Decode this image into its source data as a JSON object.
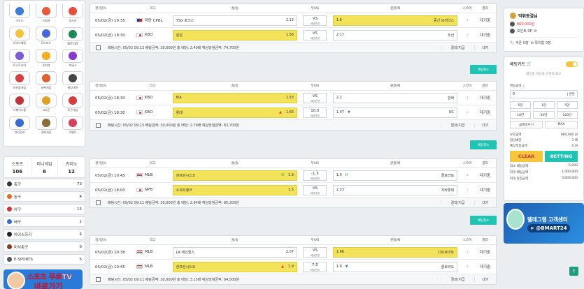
{
  "left_menu": {
    "icons": [
      {
        "label": "크로스",
        "color": "#3c7ad9"
      },
      {
        "label": "스페셜",
        "color": "#e85b3a"
      },
      {
        "label": "실시간",
        "color": "#e8503c"
      },
      {
        "label": "라이브배팅",
        "color": "#f6c33a"
      },
      {
        "label": "E스포츠",
        "color": "#4a66d8"
      },
      {
        "label": "BET365",
        "color": "#1c8a52"
      },
      {
        "label": "토스트리아",
        "color": "#7a5ad8"
      },
      {
        "label": "슈퍼맨",
        "color": "#f0b020"
      },
      {
        "label": "파워스",
        "color": "#8a3ad0"
      },
      {
        "label": "파워볼게임",
        "color": "#d84040"
      },
      {
        "label": "슬롯게임",
        "color": "#e06030"
      },
      {
        "label": "배팅내역",
        "color": "#444444"
      },
      {
        "label": "스페이스볼",
        "color": "#c0303a"
      },
      {
        "label": "크라운",
        "color": "#e0a020"
      },
      {
        "label": "토큰게임",
        "color": "#d83a3a"
      },
      {
        "label": "경기검색",
        "color": "#3a6ad8"
      },
      {
        "label": "경매게임",
        "color": "#8a6a3a"
      },
      {
        "label": "이벤트",
        "color": "#d84060"
      }
    ],
    "counts": [
      {
        "title": "스포츠",
        "num": "106"
      },
      {
        "title": "미니게임",
        "num": "6"
      },
      {
        "title": "카지노",
        "num": "12"
      }
    ],
    "sports": [
      {
        "name": "축구",
        "count": "73",
        "color": "#333333"
      },
      {
        "name": "농구",
        "count": "4",
        "color": "#e07020"
      },
      {
        "name": "야구",
        "count": "15",
        "color": "#c33"
      },
      {
        "name": "배구",
        "count": "1",
        "color": "#3a6ad8"
      },
      {
        "name": "아이스하키",
        "count": "4",
        "color": "#222222"
      },
      {
        "name": "미식축구",
        "count": "0",
        "color": "#8a3a20"
      },
      {
        "name": "E-SPORTS",
        "count": "5",
        "color": "#555555"
      }
    ],
    "banner": {
      "line1": "스포츠 무료TV",
      "line2": "바로가기"
    }
  },
  "header": {
    "time": "경기일시",
    "league": "리그",
    "home": "홈/승",
    "vs": "무/VS",
    "away": "원정/패",
    "score": "스코어",
    "result": "결과"
  },
  "slips": [
    {
      "rows": [
        {
          "time": "05/02(금) 19:35",
          "flag": "tw",
          "league": "대만 CPBL",
          "home": "TSG 호크스",
          "home_odd": "2.13",
          "home_sel": false,
          "home_up": false,
          "vs1": "VS",
          "vs2": "배당변경",
          "away": "중신 브러더스",
          "away_odd": "1.6",
          "away_sel": true,
          "away_dn": false,
          "score": ":",
          "result": "대기중"
        },
        {
          "time": "05/02(금) 18:30",
          "flag": "kr",
          "league": "KBO",
          "home": "삼성",
          "home_odd": "1.56",
          "home_sel": true,
          "home_up": false,
          "vs1": "VS",
          "vs2": "배당변경",
          "away": "두산",
          "away_odd": "2.17",
          "away_sel": false,
          "away_dn": false,
          "score": ":",
          "result": "대기중"
        }
      ],
      "footer": {
        "info": "배팅시간: 05/02 09:13   배팅금액: 30,000원   총 배당: 2.49배   예상당첨금액: 74,700원",
        "f1": "결과/지급",
        "f2": "대기"
      },
      "cancel": "배팅취소"
    },
    {
      "rows": [
        {
          "time": "05/02(금) 18:30",
          "flag": "kr",
          "league": "KBO",
          "home": "KIA",
          "home_odd": "1.53",
          "home_sel": true,
          "home_up": false,
          "vs1": "VS",
          "vs2": "배당변경",
          "away": "한화",
          "away_odd": "2.2",
          "away_sel": false,
          "away_dn": false,
          "score": ":",
          "result": "대기중"
        },
        {
          "time": "05/02(금) 18:30",
          "flag": "kr",
          "league": "KBO",
          "home": "롯데",
          "home_odd": "1.83",
          "home_sel": true,
          "home_up": true,
          "vs1": "10.5",
          "vs2": "배당변경",
          "away": "NC",
          "away_odd": "1.97",
          "away_sel": false,
          "away_dn": true,
          "score": ":",
          "result": "대기중"
        }
      ],
      "footer": {
        "info": "배팅시간: 05/02 09:13   배팅금액: 30,000원   총 배당: 2.79배   예상당첨금액: 83,700원",
        "f1": "결과/지급",
        "f2": "대기"
      },
      "cancel": "배팅취소"
    },
    {
      "rows": [
        {
          "time": "05/02(금) 10:45",
          "flag": "us",
          "league": "MLB",
          "home": "샌프란시스코",
          "home_odd": "1.9",
          "home_sel": true,
          "home_up": false,
          "home_h": "H",
          "vs1": "-1.5",
          "vs2": "배당변경",
          "away": "콜로라도",
          "away_odd": "1.9",
          "away_sel": false,
          "away_dn": false,
          "away_h": "H",
          "score": ":",
          "result": "대기중"
        },
        {
          "time": "05/02(금) 18:00",
          "flag": "jp",
          "league": "NPB",
          "home": "소프트뱅크",
          "home_odd": "1.5",
          "home_sel": true,
          "home_up": false,
          "vs1": "VS",
          "vs2": "배당변경",
          "away": "지바롯데",
          "away_odd": "2.23",
          "away_sel": false,
          "away_dn": false,
          "score": ":",
          "result": "대기중"
        }
      ],
      "footer": {
        "info": "배팅시간: 05/02 09:11   배팅금액: 30,000원   총 배당: 2.84배   예상당첨금액: 85,200원",
        "f1": "결과/지급",
        "f2": "대기"
      },
      "cancel": "배팅취소"
    },
    {
      "rows": [
        {
          "time": "05/02(금) 10:38",
          "flag": "us",
          "league": "MLB",
          "home": "LA 에인절스",
          "home_odd": "2.07",
          "home_sel": false,
          "home_up": false,
          "vs1": "VS",
          "vs2": "배당변경",
          "away": "디트로이트",
          "away_odd": "1.66",
          "away_sel": true,
          "away_dn": false,
          "score": ":",
          "result": "대기중"
        },
        {
          "time": "05/02(금) 10:45",
          "flag": "us",
          "league": "MLB",
          "home": "샌프란시스코",
          "home_odd": "1.9",
          "home_sel": true,
          "home_up": true,
          "vs1": "7.5",
          "vs2": "배당변경",
          "away": "콜로라도",
          "away_odd": "1.9",
          "away_sel": false,
          "away_dn": true,
          "score": ":",
          "result": "대기중"
        }
      ],
      "footer": {
        "info": "배팅시간: 05/02 09:11   배팅금액: 30,000원   총 배당: 3.15배   예상당첨금액: 94,500원",
        "f1": "결과/지급",
        "f2": "대기"
      }
    }
  ],
  "user": {
    "name": "먹튀종결님",
    "money": "860,000원",
    "point": "포인트 0P",
    "coupon": "쿠폰 0장",
    "note": "쪽지함 0장"
  },
  "betslip": {
    "title": "배팅카트",
    "empty": "배팅할 게임을 선택하세요!",
    "amount_label": "배팅금액",
    "amount": "0",
    "unit": "| 잔돈",
    "quick": [
      "5천",
      "1만",
      "5만",
      "10만",
      "50만",
      "100만"
    ],
    "quick2": [
      "금액비우기",
      "MAX"
    ],
    "stats": [
      {
        "k": "보유금액",
        "v": "860,000 원"
      },
      {
        "k": "합산배당",
        "v": "1 배"
      },
      {
        "k": "예상적중금액",
        "v": "0 원"
      }
    ],
    "clear": "CLEAR",
    "bet": "BETTING",
    "limits": [
      {
        "k": "최소 배팅금액",
        "v": "5,000"
      },
      {
        "k": "최대 배팅금액",
        "v": "1,000,000"
      },
      {
        "k": "최대 당첨금액",
        "v": "3,000,000"
      }
    ]
  },
  "cs": {
    "line1": "텔레그램 고객센터",
    "line2": "@BMART24"
  },
  "totop": "↑"
}
